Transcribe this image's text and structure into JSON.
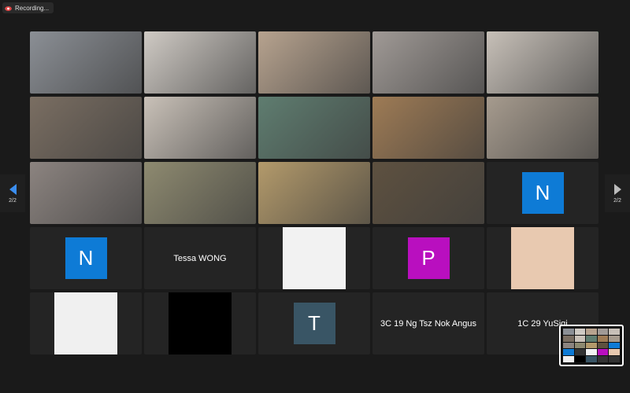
{
  "recording": {
    "label": "Recording..."
  },
  "pager": {
    "left_label": "2/2",
    "right_label": "2/2"
  },
  "colors": {
    "background": "#1a1a1a",
    "tile": "#242424",
    "active_border": "#23d959",
    "avatar_n": "#0e7bd6",
    "avatar_p": "#b90fbf",
    "avatar_t": "#395565",
    "recording_red": "#e04848"
  },
  "tiles": [
    {
      "kind": "video",
      "desc": "participant holding terrarium",
      "tone": "#8b8f95"
    },
    {
      "kind": "video",
      "desc": "drawing on whiteboard",
      "tone": "#cfcac4"
    },
    {
      "kind": "video",
      "desc": "participants with glass bowl",
      "tone": "#b7a38f"
    },
    {
      "kind": "video",
      "desc": "participant with terrarium",
      "tone": "#a09a96"
    },
    {
      "kind": "video",
      "desc": "two participants with terrarium",
      "tone": "#c7c0b8",
      "active": true
    },
    {
      "kind": "video",
      "desc": "participants smiling with terrarium",
      "tone": "#7a6e62"
    },
    {
      "kind": "video",
      "desc": "participant making peace sign",
      "tone": "#c9c1b8"
    },
    {
      "kind": "video",
      "desc": "participant holding glass bowl",
      "tone": "#5f7d70"
    },
    {
      "kind": "video",
      "desc": "participants with terrarium",
      "tone": "#9e7b55"
    },
    {
      "kind": "video",
      "desc": "participants with large terrarium",
      "tone": "#a69b8e"
    },
    {
      "kind": "video",
      "desc": "hands holding terrarium",
      "tone": "#8c8480"
    },
    {
      "kind": "video",
      "desc": "participant with terrarium plants",
      "tone": "#8e8a70"
    },
    {
      "kind": "video",
      "desc": "participants in room",
      "tone": "#b39a6b"
    },
    {
      "kind": "video",
      "desc": "participants in dim room",
      "tone": "#5e5140"
    },
    {
      "kind": "avatar",
      "letter": "N",
      "color": "#0e7bd6"
    },
    {
      "kind": "avatar",
      "letter": "N",
      "color": "#0e7bd6"
    },
    {
      "kind": "name",
      "name": "Tessa WONG"
    },
    {
      "kind": "image",
      "desc": "cartoon dog avatar",
      "tone": "#f2f2f2"
    },
    {
      "kind": "avatar",
      "letter": "P",
      "color": "#b90fbf"
    },
    {
      "kind": "image",
      "desc": "cartoon face avatar",
      "tone": "#e8c9b0"
    },
    {
      "kind": "image",
      "desc": "cartoon laughing face avatar",
      "tone": "#f0f0f0"
    },
    {
      "kind": "image",
      "desc": "black video",
      "tone": "#000000"
    },
    {
      "kind": "avatar",
      "letter": "T",
      "color": "#395565"
    },
    {
      "kind": "name",
      "name": "3C 19 Ng Tsz Nok Angus"
    },
    {
      "kind": "name",
      "name": "1C 29 YuSiqi"
    }
  ]
}
